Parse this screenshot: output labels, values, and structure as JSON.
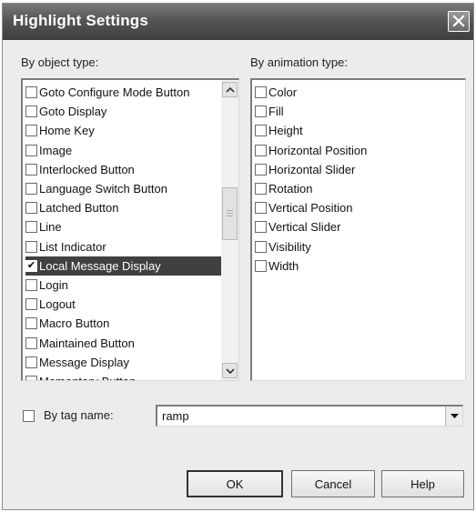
{
  "window": {
    "title": "Highlight Settings"
  },
  "object_type": {
    "label": "By object type:",
    "items": [
      {
        "label": "Goto Configure Mode Button",
        "checked": false
      },
      {
        "label": "Goto Display",
        "checked": false
      },
      {
        "label": "Home Key",
        "checked": false
      },
      {
        "label": "Image",
        "checked": false
      },
      {
        "label": "Interlocked Button",
        "checked": false
      },
      {
        "label": "Language Switch Button",
        "checked": false
      },
      {
        "label": "Latched Button",
        "checked": false
      },
      {
        "label": "Line",
        "checked": false
      },
      {
        "label": "List Indicator",
        "checked": false
      },
      {
        "label": "Local Message Display",
        "checked": true,
        "selected": true
      },
      {
        "label": "Login",
        "checked": false
      },
      {
        "label": "Logout",
        "checked": false
      },
      {
        "label": "Macro Button",
        "checked": false
      },
      {
        "label": "Maintained Button",
        "checked": false
      },
      {
        "label": "Message Display",
        "checked": false
      },
      {
        "label": "Momentary Button",
        "checked": false
      }
    ]
  },
  "animation_type": {
    "label": "By animation type:",
    "items": [
      {
        "label": "Color",
        "checked": false
      },
      {
        "label": "Fill",
        "checked": false
      },
      {
        "label": "Height",
        "checked": false
      },
      {
        "label": "Horizontal Position",
        "checked": false
      },
      {
        "label": "Horizontal Slider",
        "checked": false
      },
      {
        "label": "Rotation",
        "checked": false
      },
      {
        "label": "Vertical Position",
        "checked": false
      },
      {
        "label": "Vertical Slider",
        "checked": false
      },
      {
        "label": "Visibility",
        "checked": false
      },
      {
        "label": "Width",
        "checked": false
      }
    ]
  },
  "tag": {
    "label": "By tag name:",
    "checked": false,
    "value": "ramp"
  },
  "buttons": {
    "ok": "OK",
    "cancel": "Cancel",
    "help": "Help"
  },
  "icons": {
    "close": "close-icon",
    "check": "✔",
    "scroll_up": "chevron-up-icon",
    "scroll_down": "chevron-down-icon",
    "dropdown": "dropdown-arrow-icon"
  }
}
